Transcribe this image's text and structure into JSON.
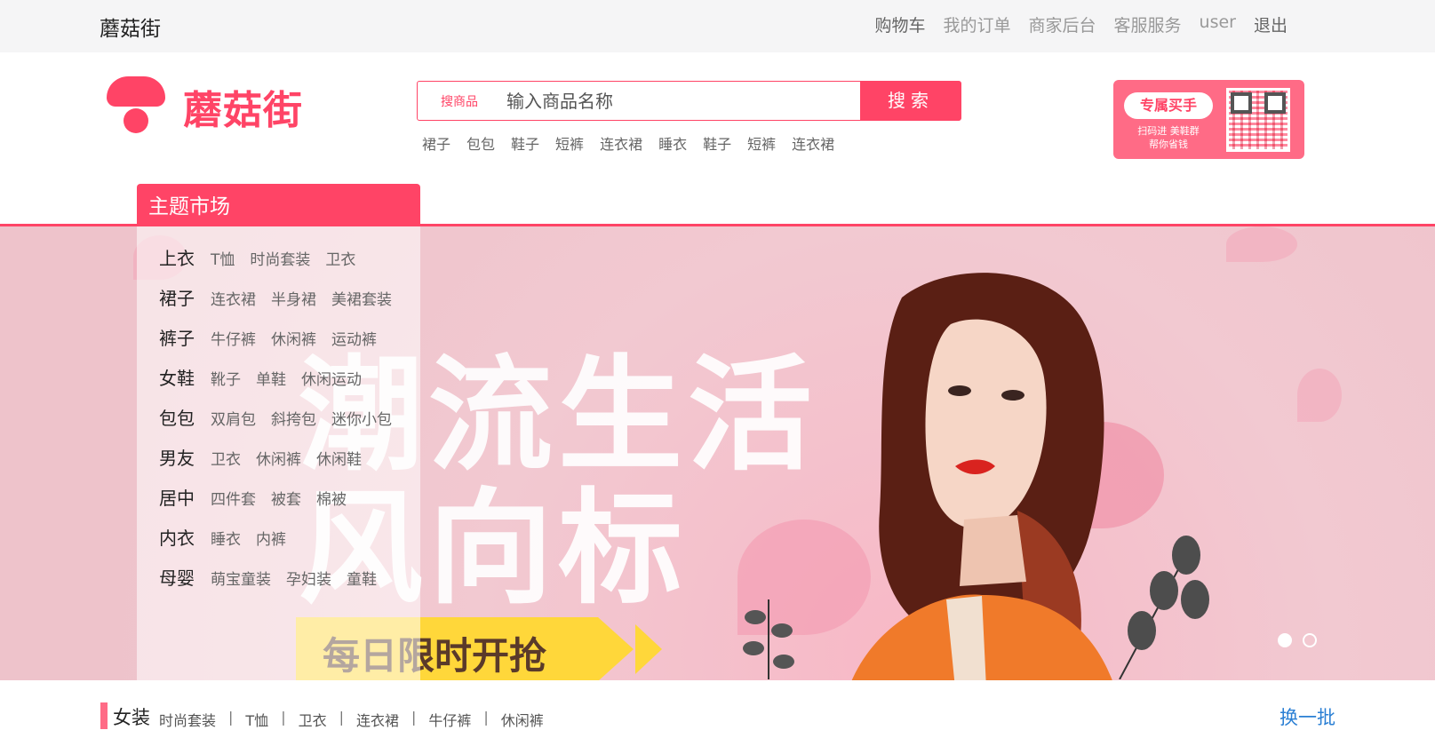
{
  "topbar": {
    "site_name": "蘑菇街",
    "links": [
      "购物车",
      "我的订单",
      "商家后台",
      "客服服务",
      "user",
      "退出"
    ]
  },
  "logo": {
    "text": "蘑菇街"
  },
  "search": {
    "scope": "搜商品",
    "placeholder": "输入商品名称",
    "button": "搜索"
  },
  "hotwords": [
    "裙子",
    "包包",
    "鞋子",
    "短裤",
    "连衣裙",
    "睡衣",
    "鞋子",
    "短裤",
    "连衣裙"
  ],
  "qr_card": {
    "pill": "专属买手",
    "line1": "扫码进 美鞋群",
    "line2": "帮你省钱"
  },
  "category_tab": "主题市场",
  "categories": [
    {
      "main": "上衣",
      "subs": [
        "T恤",
        "时尚套装",
        "卫衣"
      ]
    },
    {
      "main": "裙子",
      "subs": [
        "连衣裙",
        "半身裙",
        "美裙套装"
      ]
    },
    {
      "main": "裤子",
      "subs": [
        "牛仔裤",
        "休闲裤",
        "运动裤"
      ]
    },
    {
      "main": "女鞋",
      "subs": [
        "靴子",
        "单鞋",
        "休闲运动"
      ]
    },
    {
      "main": "包包",
      "subs": [
        "双肩包",
        "斜挎包",
        "迷你小包"
      ]
    },
    {
      "main": "男友",
      "subs": [
        "卫衣",
        "休闲裤",
        "休闲鞋"
      ]
    },
    {
      "main": "居中",
      "subs": [
        "四件套",
        "被套",
        "棉被"
      ]
    },
    {
      "main": "内衣",
      "subs": [
        "睡衣",
        "内裤"
      ]
    },
    {
      "main": "母婴",
      "subs": [
        "萌宝童装",
        "孕妇装",
        "童鞋"
      ]
    }
  ],
  "banner": {
    "headline1": "潮流生活",
    "headline2": "风向标",
    "ribbon": "每日限时开抢",
    "slide_count": 2,
    "active_slide": 0
  },
  "floor": {
    "title": "女装",
    "items": [
      "时尚套装",
      "T恤",
      "卫衣",
      "连衣裙",
      "牛仔裤",
      "休闲裤"
    ],
    "refresh": "换一批"
  },
  "colors": {
    "accent": "#ff4466",
    "link": "#2a7fd4"
  }
}
